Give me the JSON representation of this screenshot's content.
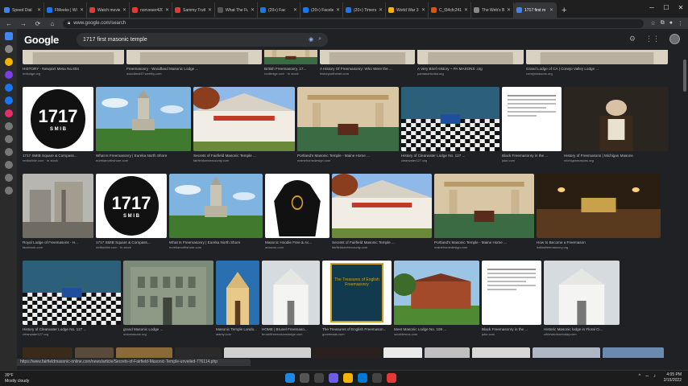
{
  "browser": {
    "tabs": [
      {
        "title": "Speed Dial",
        "color": "#3b82f6"
      },
      {
        "title": "FMeeks | Wi",
        "color": "#1877f2"
      },
      {
        "title": "Watch movie",
        "color": "#e53935"
      },
      {
        "title": "nonveser420",
        "color": "#e53935"
      },
      {
        "title": "Sammy Trutt",
        "color": "#e53935"
      },
      {
        "title": "What The Fu",
        "color": "#555555"
      },
      {
        "title": "(20+) Fac",
        "color": "#1877f2"
      },
      {
        "title": "(20+) Facebo",
        "color": "#1877f2"
      },
      {
        "title": "(20+) Timers",
        "color": "#1877f2"
      },
      {
        "title": "World War 3",
        "color": "#f4b400"
      },
      {
        "title": "C_f34cfc241",
        "color": "#e65100"
      },
      {
        "title": "The Web's B",
        "color": "#888888"
      },
      {
        "title": "1717 first m",
        "color": "#4285f4"
      }
    ],
    "new_tab": "+",
    "url": "www.google.com/search"
  },
  "google": {
    "logo": "Google",
    "query": "1717 first masonic temple"
  },
  "rows": [
    [
      {
        "title": "HISTORY - Newport Mesa No.604",
        "source": "nmlodge.org",
        "w": 126
      },
      {
        "title": "Freemasonry - Woodland Masonic Lodge ...",
        "source": "woodland47.weebly.com",
        "w": 168
      },
      {
        "title": "British Freemasonry, 17...",
        "source": "routledge.com · In stock",
        "w": 66
      },
      {
        "title": "A History Of Freemasonry: Who Were the ...",
        "source": "historyonthenet.com",
        "w": 118
      },
      {
        "title": "A Very Brief History ~ PA MASONS .org",
        "source": "pamasonicdsa.org",
        "w": 132
      },
      {
        "title": "Grand Lodge of CA | Conejo Valley Lodge ...",
        "source": "conejomasons.org",
        "w": 176
      }
    ],
    [
      {
        "title": "1717 SMIB Square & Compass...",
        "source": "redbubble.com · In stock",
        "w": 88
      },
      {
        "title": "What Is Freemasonry | Eureka North Shore",
        "source": "eurekanorthshore.com",
        "w": 118
      },
      {
        "title": "Secrets of Fairfield Masonic Temple ...",
        "source": "fairfieldcentercounty.com",
        "w": 126
      },
      {
        "title": "Portland's Masonic Temple - Maine Home ...",
        "source": "mainehomedesign.com",
        "w": 126
      },
      {
        "title": "History of Clearwater Lodge No. 127 ...",
        "source": "clearwater127.org",
        "w": 122
      },
      {
        "title": "Black Freemasonry in the ...",
        "source": "jstor.com",
        "w": 74
      },
      {
        "title": "History of Freemasons | Michigan Masons",
        "source": "michiganmasons.org",
        "w": 130
      }
    ],
    [
      {
        "title": "Royal Lodge of Freemasons - H...",
        "source": "facebook.com",
        "w": 88
      },
      {
        "title": "1717 SMIB Square & Compass...",
        "source": "redbubble.com · In stock",
        "w": 88
      },
      {
        "title": "What Is Freemasonry | Eureka North Shore",
        "source": "eurekanorthshore.com",
        "w": 116
      },
      {
        "title": "Masonic Hoodie Free & Ac...",
        "source": "amazon.com",
        "w": 80
      },
      {
        "title": "Secrets of Fairfield Masonic Temple ...",
        "source": "fairfieldcentercounty.com",
        "w": 124
      },
      {
        "title": "Portland's Masonic Temple - Maine Home ...",
        "source": "mainehomedesign.com",
        "w": 124
      },
      {
        "title": "How to Become a Freemason",
        "source": "dallasfreemasonry.org",
        "w": 154
      }
    ],
    [
      {
        "title": "History of Clearwater Lodge No. 127 ...",
        "source": "clearwater127.org",
        "w": 122
      },
      {
        "title": "grand Masonic Lodge ...",
        "source": "ontomasons.org",
        "w": 112
      },
      {
        "title": "Masonic Temple Londo...",
        "source": "alamy.com",
        "w": 54
      },
      {
        "title": "HOME | Brunel Freemaso...",
        "source": "brunelfreemasonslodge.com",
        "w": 72
      },
      {
        "title": "The Treasures of English Freemason...",
        "source": "goodreads.com",
        "w": 86
      },
      {
        "title": "Meet Masonic Lodge No. 108 ...",
        "source": "smoldemos.com",
        "w": 106
      },
      {
        "title": "Black Freemasonry in the ...",
        "source": "jstor.com",
        "w": 74
      },
      {
        "title": "Historic Masonic lodge in Floral Ci...",
        "source": "citnewsofourtoday.com",
        "w": 94
      }
    ]
  ],
  "badge_text": {
    "main": "1717",
    "sub": "S M I B"
  },
  "book_title": "The Treasures of English Freemasonry",
  "status_url": "https://www.fairfieldmasonic-online.com/news/article/Secrets-of-Fairfield-Masonic-Temple-unveiled-776114.php",
  "taskbar": {
    "weather_temp": "39°F",
    "weather_desc": "Mostly cloudy",
    "time": "4:05 PM",
    "date": "2/15/2022"
  }
}
